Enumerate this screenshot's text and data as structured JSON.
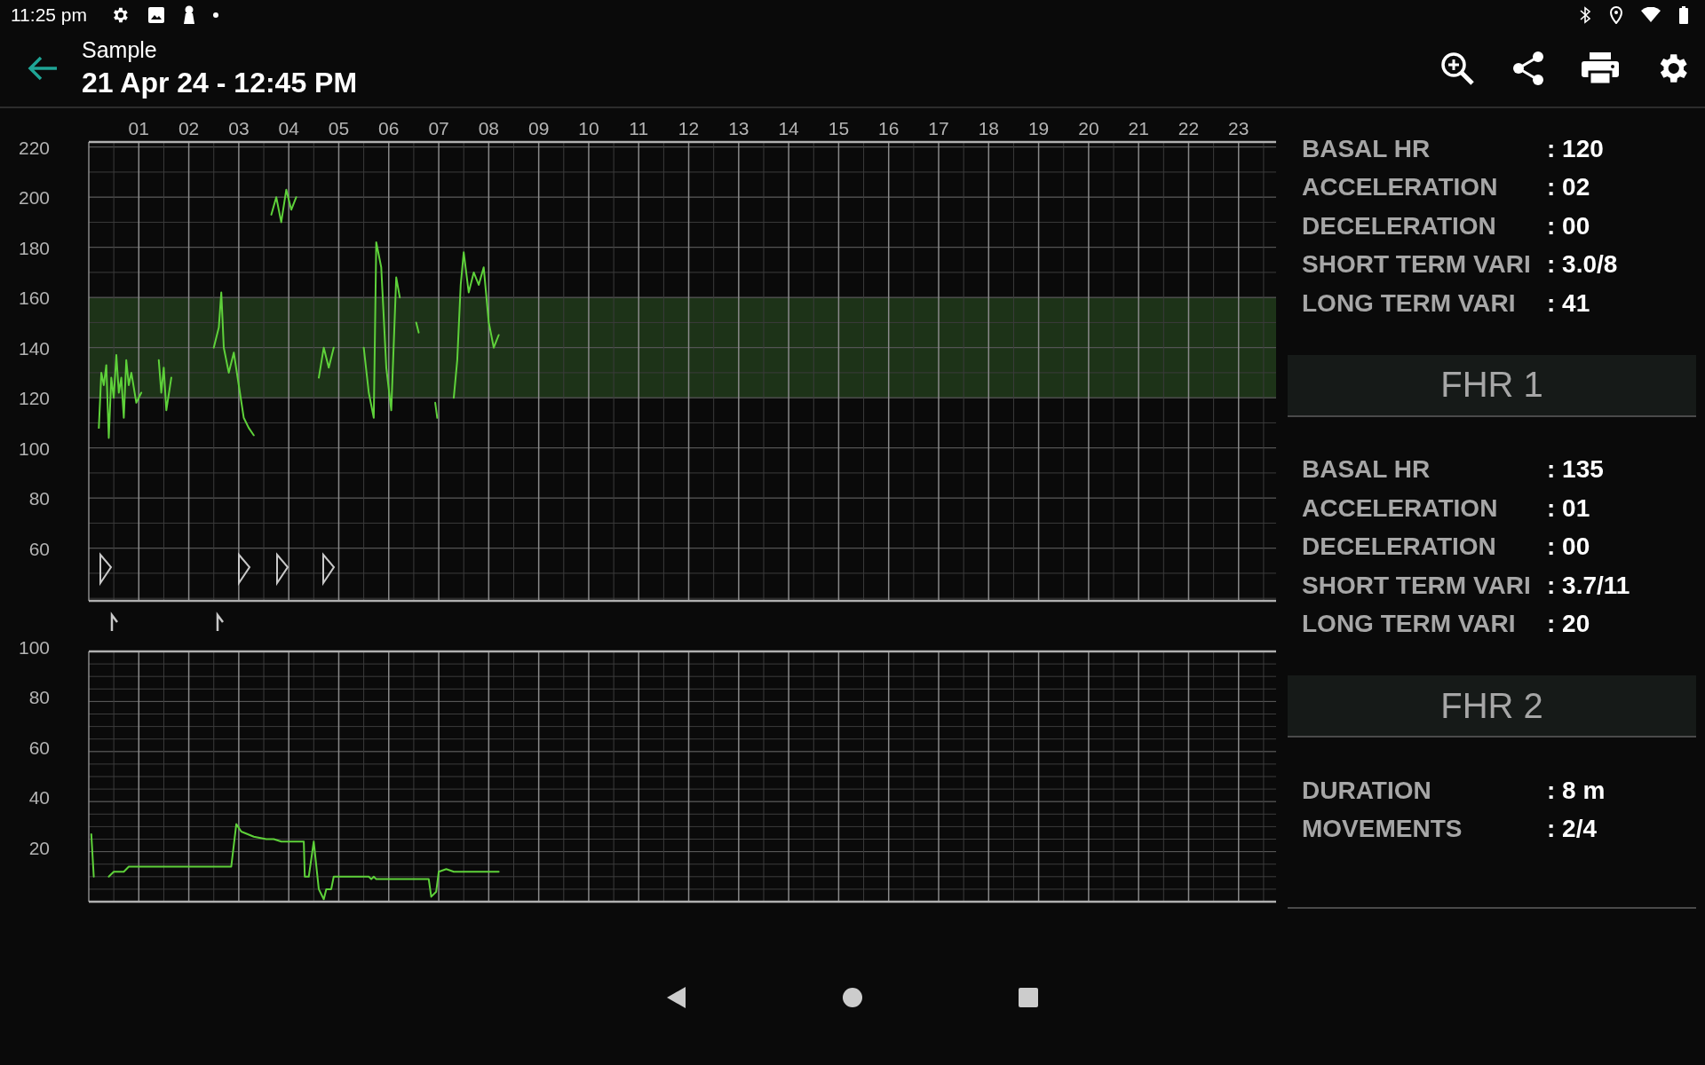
{
  "status_bar": {
    "time": "11:25 pm"
  },
  "app_bar": {
    "subtitle": "Sample",
    "title": "21 Apr 24 - 12:45 PM"
  },
  "charts": [
    {
      "chart_data": {
        "type": "line",
        "xlim": [
          0,
          23.75
        ],
        "ylim": [
          39,
          222
        ],
        "xticks": [
          {
            "value": 1,
            "label": "01"
          },
          {
            "value": 2,
            "label": "02"
          },
          {
            "value": 3,
            "label": "03"
          },
          {
            "value": 4,
            "label": "04"
          },
          {
            "value": 5,
            "label": "05"
          },
          {
            "value": 6,
            "label": "06"
          },
          {
            "value": 7,
            "label": "07"
          },
          {
            "value": 8,
            "label": "08"
          },
          {
            "value": 9,
            "label": "09"
          },
          {
            "value": 10,
            "label": "10"
          },
          {
            "value": 11,
            "label": "11"
          },
          {
            "value": 12,
            "label": "12"
          },
          {
            "value": 13,
            "label": "13"
          },
          {
            "value": 14,
            "label": "14"
          },
          {
            "value": 15,
            "label": "15"
          },
          {
            "value": 16,
            "label": "16"
          },
          {
            "value": 17,
            "label": "17"
          },
          {
            "value": 18,
            "label": "18"
          },
          {
            "value": 19,
            "label": "19"
          },
          {
            "value": 20,
            "label": "20"
          },
          {
            "value": 21,
            "label": "21"
          },
          {
            "value": 22,
            "label": "22"
          },
          {
            "value": 23,
            "label": "23"
          }
        ],
        "yticks": [
          60,
          80,
          100,
          120,
          140,
          160,
          180,
          200,
          220
        ],
        "grid": true,
        "x": [
          0.2,
          0.25,
          0.3,
          0.35,
          0.4,
          0.45,
          0.5,
          0.55,
          0.6,
          0.65,
          0.7,
          0.75,
          0.8,
          0.85,
          0.95,
          1.05,
          1.4,
          1.45,
          1.5,
          1.55,
          1.65,
          2.5,
          2.6,
          2.65,
          2.7,
          2.75,
          2.8,
          2.9,
          3.0,
          3.1,
          3.2,
          3.3,
          3.65,
          3.75,
          3.85,
          3.95,
          4.05,
          4.15,
          4.6,
          4.7,
          4.8,
          4.9,
          5.5,
          5.6,
          5.7,
          5.75,
          5.85,
          5.95,
          6.05,
          6.15,
          6.22,
          6.55,
          6.6,
          6.93,
          6.97,
          7.3,
          7.37,
          7.44,
          7.5,
          7.6,
          7.7,
          7.8,
          7.9,
          8.0,
          8.1,
          8.2
        ],
        "series": [
          {
            "color": "#5ed13a",
            "values": [
              108,
              130,
              125,
              133,
              104,
              128,
              120,
              137,
              122,
              128,
              112,
              135,
              125,
              130,
              118,
              122,
              135,
              122,
              132,
              115,
              128,
              140,
              148,
              162,
              140,
              135,
              130,
              138,
              125,
              112,
              108,
              105,
              193,
              200,
              190,
              203,
              195,
              200,
              128,
              140,
              132,
              140,
              140,
              122,
              112,
              182,
              172,
              132,
              115,
              168,
              160,
              150,
              146,
              118,
              112,
              120,
              135,
              165,
              178,
              162,
              170,
              165,
              172,
              150,
              140,
              145
            ]
          }
        ],
        "bands": [
          {
            "axis": "y",
            "from": 120,
            "to": 160
          }
        ]
      }
    },
    {
      "chart_data": {
        "type": "line",
        "xlim": [
          0,
          23.75
        ],
        "ylim": [
          0,
          100
        ],
        "yticks": [
          20,
          40,
          60,
          80,
          100
        ],
        "grid": true,
        "x": [
          0.05,
          0.1,
          0.4,
          0.5,
          0.7,
          0.8,
          1.05,
          1.3,
          1.55,
          1.8,
          2.05,
          2.3,
          2.55,
          2.8,
          2.85,
          2.95,
          3.05,
          3.3,
          3.55,
          3.7,
          3.85,
          4.1,
          4.3,
          4.32,
          4.4,
          4.5,
          4.6,
          4.7,
          4.75,
          4.85,
          4.9,
          5.15,
          5.4,
          5.6,
          5.65,
          5.7,
          5.75,
          6.0,
          6.25,
          6.5,
          6.75,
          6.8,
          6.85,
          6.95,
          7.0,
          7.15,
          7.3,
          7.55,
          7.8,
          8.05,
          8.2
        ],
        "series": [
          {
            "color": "#5ed13a",
            "values": [
              27,
              10,
              10,
              12,
              12,
              14,
              14,
              14,
              14,
              14,
              14,
              14,
              14,
              14,
              14,
              31,
              28,
              26,
              25,
              25,
              24,
              24,
              24,
              10,
              10,
              24,
              5,
              1,
              5,
              5,
              10,
              10,
              10,
              10,
              9,
              10,
              9,
              9,
              9,
              9,
              9,
              9,
              2,
              4,
              12,
              13,
              12,
              12,
              12,
              12,
              12
            ]
          }
        ]
      }
    }
  ],
  "summary": [
    {
      "kind": "row",
      "label": "BASAL HR",
      "value": ": 120"
    },
    {
      "kind": "row",
      "label": "ACCELERATION",
      "value": ": 02"
    },
    {
      "kind": "row",
      "label": "DECELERATION",
      "value": ": 00"
    },
    {
      "kind": "row",
      "label": "SHORT TERM VARI",
      "value": ": 3.0/8"
    },
    {
      "kind": "row",
      "label": "LONG TERM VARI",
      "value": ": 41"
    },
    {
      "kind": "heading",
      "label": "FHR 1"
    },
    {
      "kind": "row",
      "label": "BASAL HR",
      "value": ": 135"
    },
    {
      "kind": "row",
      "label": "ACCELERATION",
      "value": ": 01"
    },
    {
      "kind": "row",
      "label": "DECELERATION",
      "value": ": 00"
    },
    {
      "kind": "row",
      "label": "SHORT TERM VARI",
      "value": ": 3.7/11"
    },
    {
      "kind": "row",
      "label": "LONG TERM VARI",
      "value": ": 20"
    },
    {
      "kind": "heading",
      "label": "FHR 2"
    },
    {
      "kind": "row",
      "label": "DURATION",
      "value": ": 8 m"
    },
    {
      "kind": "row",
      "label": "MOVEMENTS",
      "value": ": 2/4"
    }
  ]
}
